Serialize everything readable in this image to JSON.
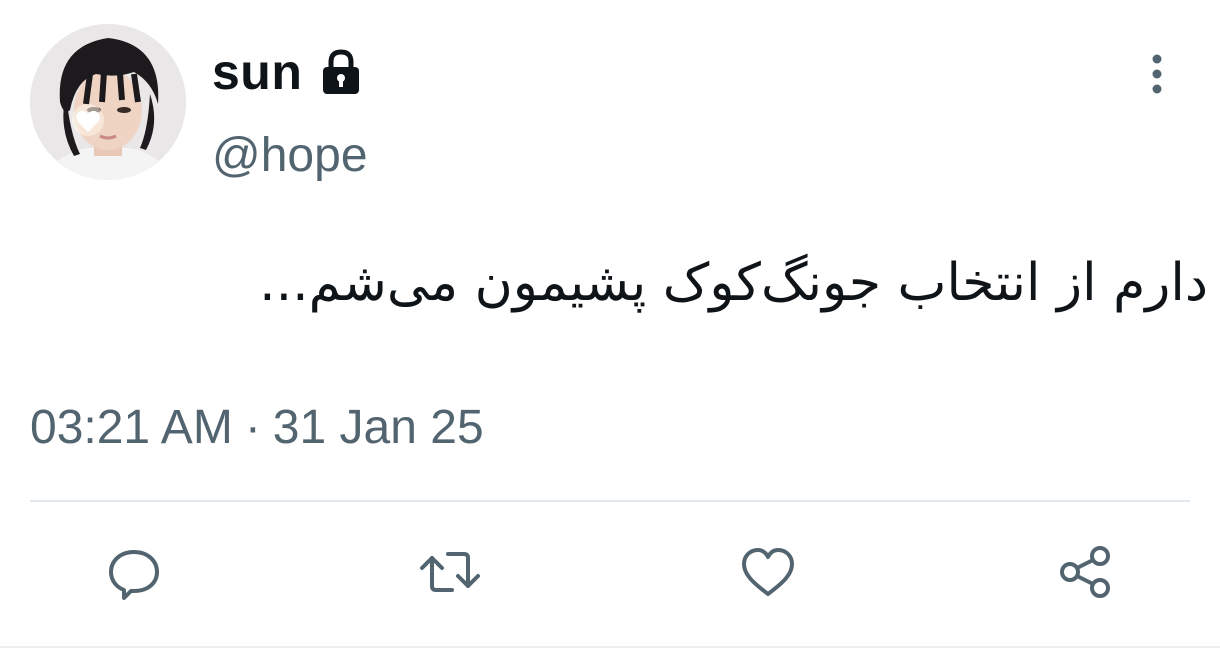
{
  "author": {
    "display_name": "sun",
    "handle": "@hope",
    "protected_icon": "lock-icon",
    "avatar_icon": "profile-photo"
  },
  "tweet": {
    "text": "دارم از انتخاب جونگ‌کوک پشیمون می‌شم...",
    "time": "03:21 AM",
    "separator": "·",
    "date": "31 Jan 25"
  },
  "menu": {
    "icon": "more-vertical-icon"
  },
  "actions": [
    {
      "name": "reply",
      "icon": "reply-icon"
    },
    {
      "name": "retweet",
      "icon": "retweet-icon"
    },
    {
      "name": "like",
      "icon": "heart-icon"
    },
    {
      "name": "share",
      "icon": "share-icon"
    }
  ],
  "colors": {
    "text": "#0f1419",
    "secondary": "#536471",
    "divider": "#e1e8ed",
    "background": "#ffffff"
  }
}
